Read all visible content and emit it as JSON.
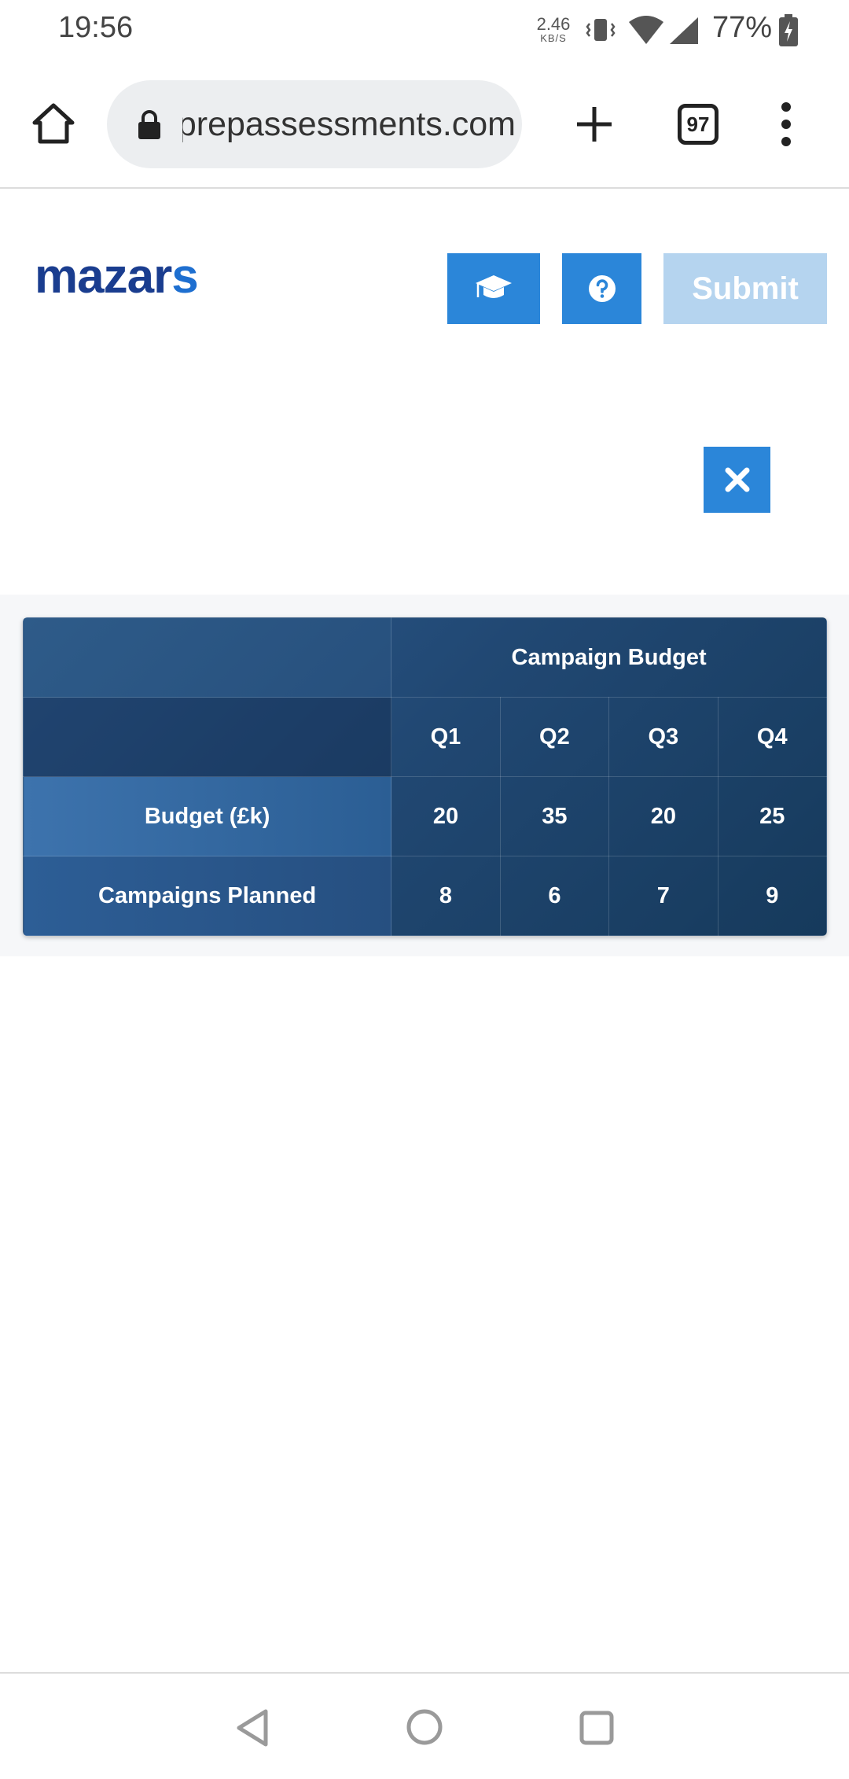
{
  "status_bar": {
    "time": "19:56",
    "network_speed_value": "2.46",
    "network_speed_unit": "KB/S",
    "battery_percent": "77%"
  },
  "browser": {
    "url": "jobtestprepassessments.com",
    "tab_count": "97"
  },
  "header": {
    "logo_main": "mazar",
    "logo_accent": "s",
    "submit_label": "Submit",
    "learn_icon": "graduation-cap-icon",
    "help_icon": "question-circle-icon",
    "close_icon": "close-x-icon"
  },
  "colors": {
    "button_blue": "#2b86d9",
    "submit_disabled": "#b5d4ef",
    "logo_dark": "#1a3d8f",
    "logo_light": "#1e6fd0",
    "table_dark": "#163a5c"
  },
  "table": {
    "group_header": "Campaign Budget",
    "columns": [
      "Q1",
      "Q2",
      "Q3",
      "Q4"
    ],
    "rows": [
      {
        "label": "Budget (£k)",
        "values": [
          "20",
          "35",
          "20",
          "25"
        ]
      },
      {
        "label": "Campaigns Planned",
        "values": [
          "8",
          "6",
          "7",
          "9"
        ]
      }
    ]
  }
}
